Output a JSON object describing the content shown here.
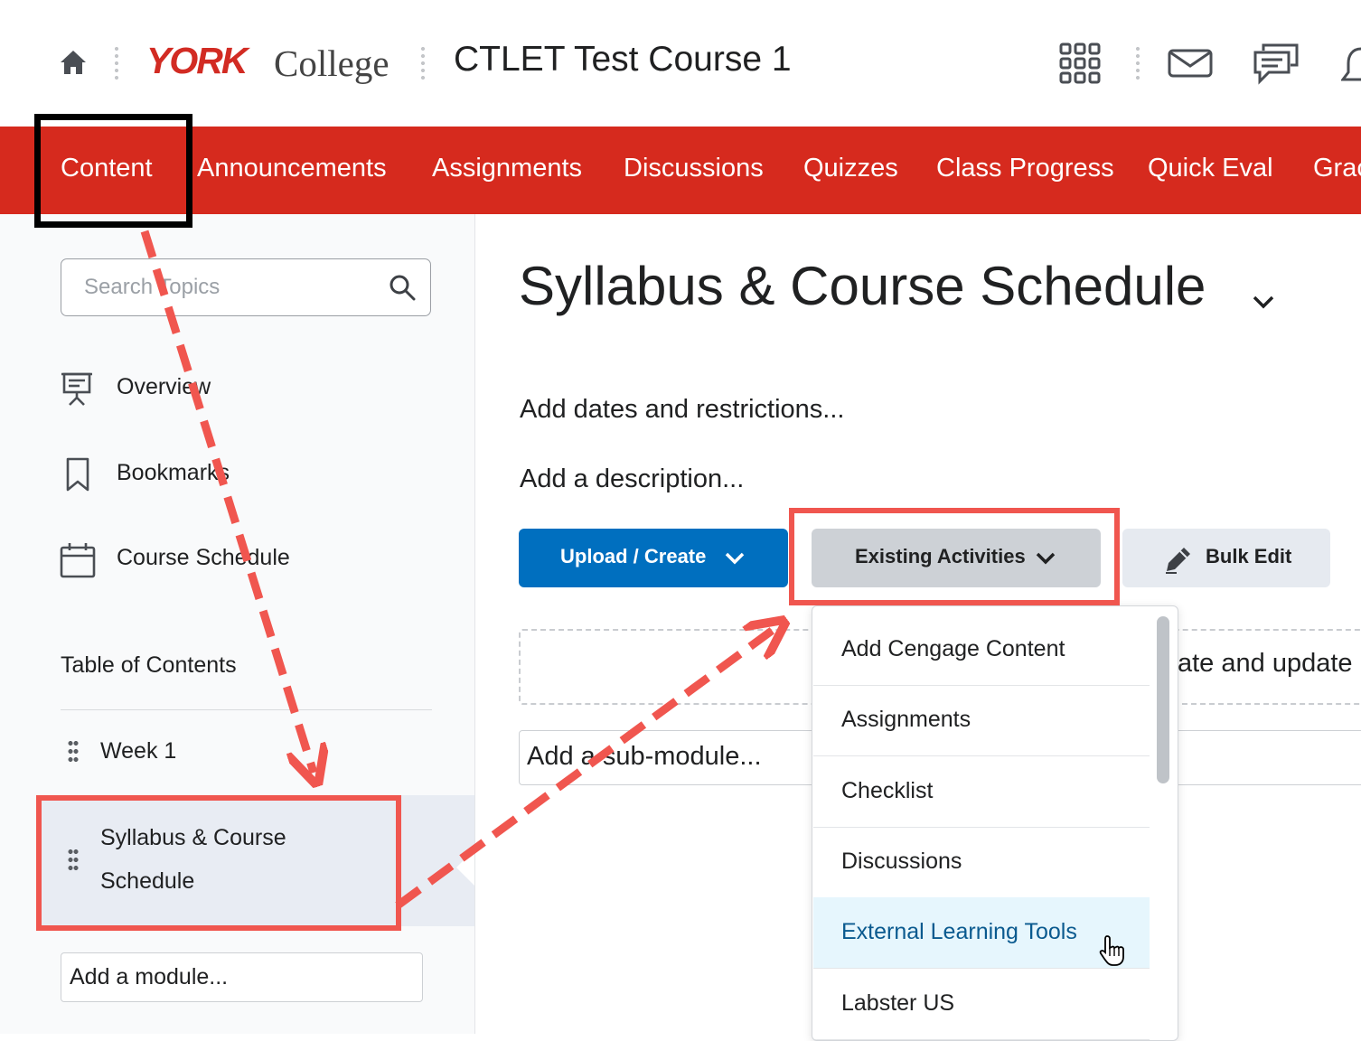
{
  "header": {
    "logo_bold": "YORK",
    "logo_rest": "College",
    "course_title": "CTLET Test Course 1"
  },
  "nav": {
    "items": [
      "Content",
      "Announcements",
      "Assignments",
      "Discussions",
      "Quizzes",
      "Class Progress",
      "Quick Eval",
      "Grac"
    ]
  },
  "sidebar": {
    "search_placeholder": "Search Topics",
    "overview": "Overview",
    "bookmarks": "Bookmarks",
    "course_schedule": "Course Schedule",
    "toc_heading": "Table of Contents",
    "modules": [
      "Week 1"
    ],
    "selected_module_line1": "Syllabus & Course",
    "selected_module_line2": "Schedule",
    "add_module": "Add a module..."
  },
  "main": {
    "heading": "Syllabus & Course Schedule",
    "dates_link": "Add dates and restrictions...",
    "description_link": "Add a description...",
    "upload_button": "Upload / Create",
    "existing_button": "Existing Activities",
    "bulk_button": "Bulk Edit",
    "dropzone_text": "ate and update",
    "sub_module": "Add a sub-module..."
  },
  "dropdown": {
    "items": [
      "Add Cengage Content",
      "Assignments",
      "Checklist",
      "Discussions",
      "External Learning Tools",
      "Labster US"
    ],
    "highlighted_index": 4
  },
  "colors": {
    "nav_red": "#d62a1e",
    "primary_blue": "#006fbf",
    "annotation_red": "#f0564f"
  }
}
